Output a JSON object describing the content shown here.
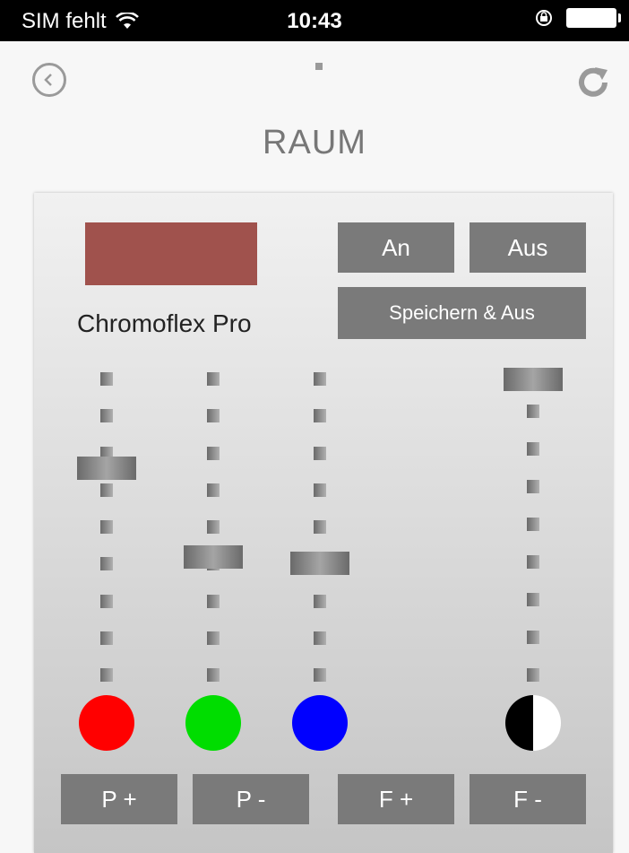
{
  "status_bar": {
    "carrier": "SIM fehlt",
    "time": "10:43"
  },
  "page": {
    "title": "RAUM"
  },
  "device": {
    "name": "Chromoflex Pro",
    "color": "#a0524d"
  },
  "buttons": {
    "on": "An",
    "off": "Aus",
    "save_off": "Speichern & Aus",
    "p_plus": "P +",
    "p_minus": "P -",
    "f_plus": "F +",
    "f_minus": "F -"
  },
  "sliders": [
    {
      "name": "red",
      "color": "#ff0000",
      "level": 0.7
    },
    {
      "name": "green",
      "color": "#00dd00",
      "level": 0.4
    },
    {
      "name": "blue",
      "color": "#0000ff",
      "level": 0.38
    },
    {
      "name": "brightness",
      "color": "black-white",
      "level": 1.0
    }
  ]
}
